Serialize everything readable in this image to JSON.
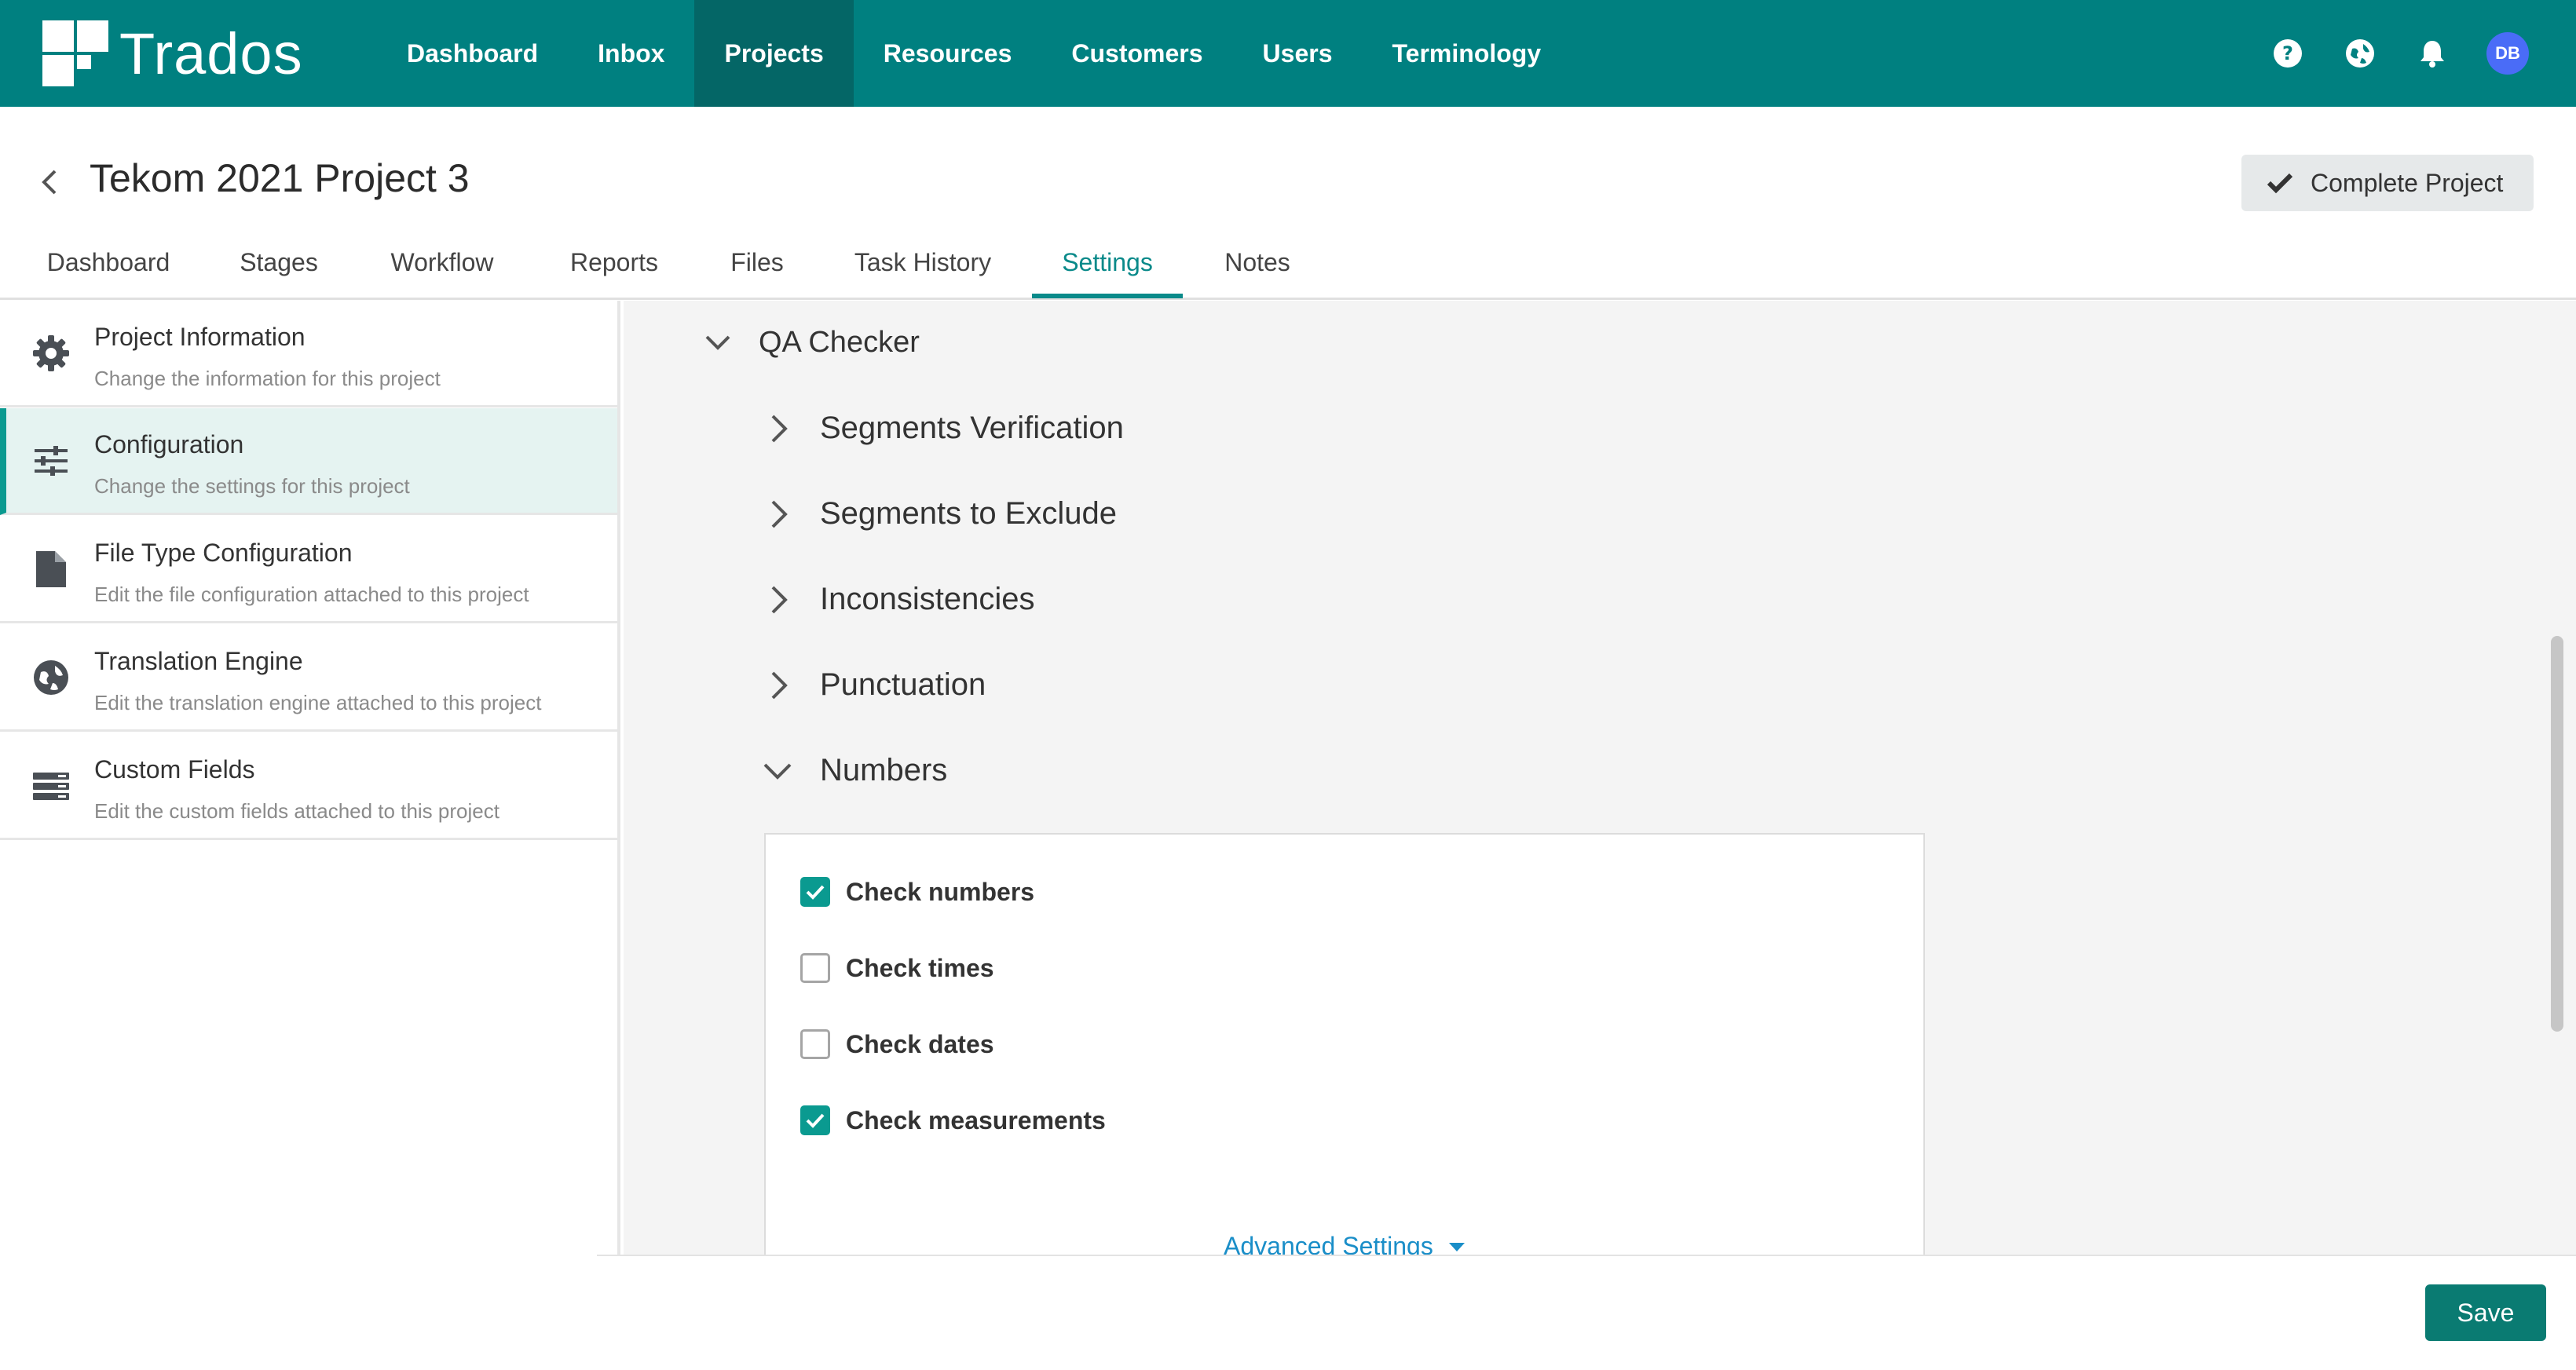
{
  "brand": {
    "name": "Trados"
  },
  "nav": {
    "links": [
      "Dashboard",
      "Inbox",
      "Projects",
      "Resources",
      "Customers",
      "Users",
      "Terminology"
    ],
    "active": "Projects",
    "avatar_initials": "DB",
    "icons": [
      "help-icon",
      "globe-icon",
      "bell-icon"
    ]
  },
  "header": {
    "title": "Tekom 2021 Project 3",
    "complete_label": "Complete Project"
  },
  "tabs": {
    "items": [
      "Dashboard",
      "Stages",
      "Workflow",
      "Reports",
      "Files",
      "Task History",
      "Settings",
      "Notes"
    ],
    "active": "Settings"
  },
  "sidebar": {
    "items": [
      {
        "title": "Project Information",
        "subtitle": "Change the information for this project",
        "icon": "gear-icon"
      },
      {
        "title": "Configuration",
        "subtitle": "Change the settings for this project",
        "icon": "sliders-icon"
      },
      {
        "title": "File Type Configuration",
        "subtitle": "Edit the file configuration attached to this project",
        "icon": "file-icon"
      },
      {
        "title": "Translation Engine",
        "subtitle": "Edit the translation engine attached to this project",
        "icon": "globe-icon"
      },
      {
        "title": "Custom Fields",
        "subtitle": "Edit the custom fields attached to this project",
        "icon": "list-icon"
      }
    ],
    "active": "Configuration"
  },
  "main": {
    "section_title": "QA Checker",
    "subsections": [
      {
        "label": "Segments Verification",
        "expanded": false
      },
      {
        "label": "Segments to Exclude",
        "expanded": false
      },
      {
        "label": "Inconsistencies",
        "expanded": false
      },
      {
        "label": "Punctuation",
        "expanded": false
      },
      {
        "label": "Numbers",
        "expanded": true
      }
    ],
    "checks": [
      {
        "label": "Check numbers",
        "checked": true
      },
      {
        "label": "Check times",
        "checked": false
      },
      {
        "label": "Check dates",
        "checked": false
      },
      {
        "label": "Check measurements",
        "checked": true
      }
    ],
    "advanced_label": "Advanced Settings"
  },
  "footer": {
    "save_label": "Save"
  },
  "colors": {
    "teal": "#008080",
    "teal_active": "#046666",
    "accent": "#0a9a90",
    "link": "#1a8ec8",
    "avatar": "#4a6cf7"
  }
}
